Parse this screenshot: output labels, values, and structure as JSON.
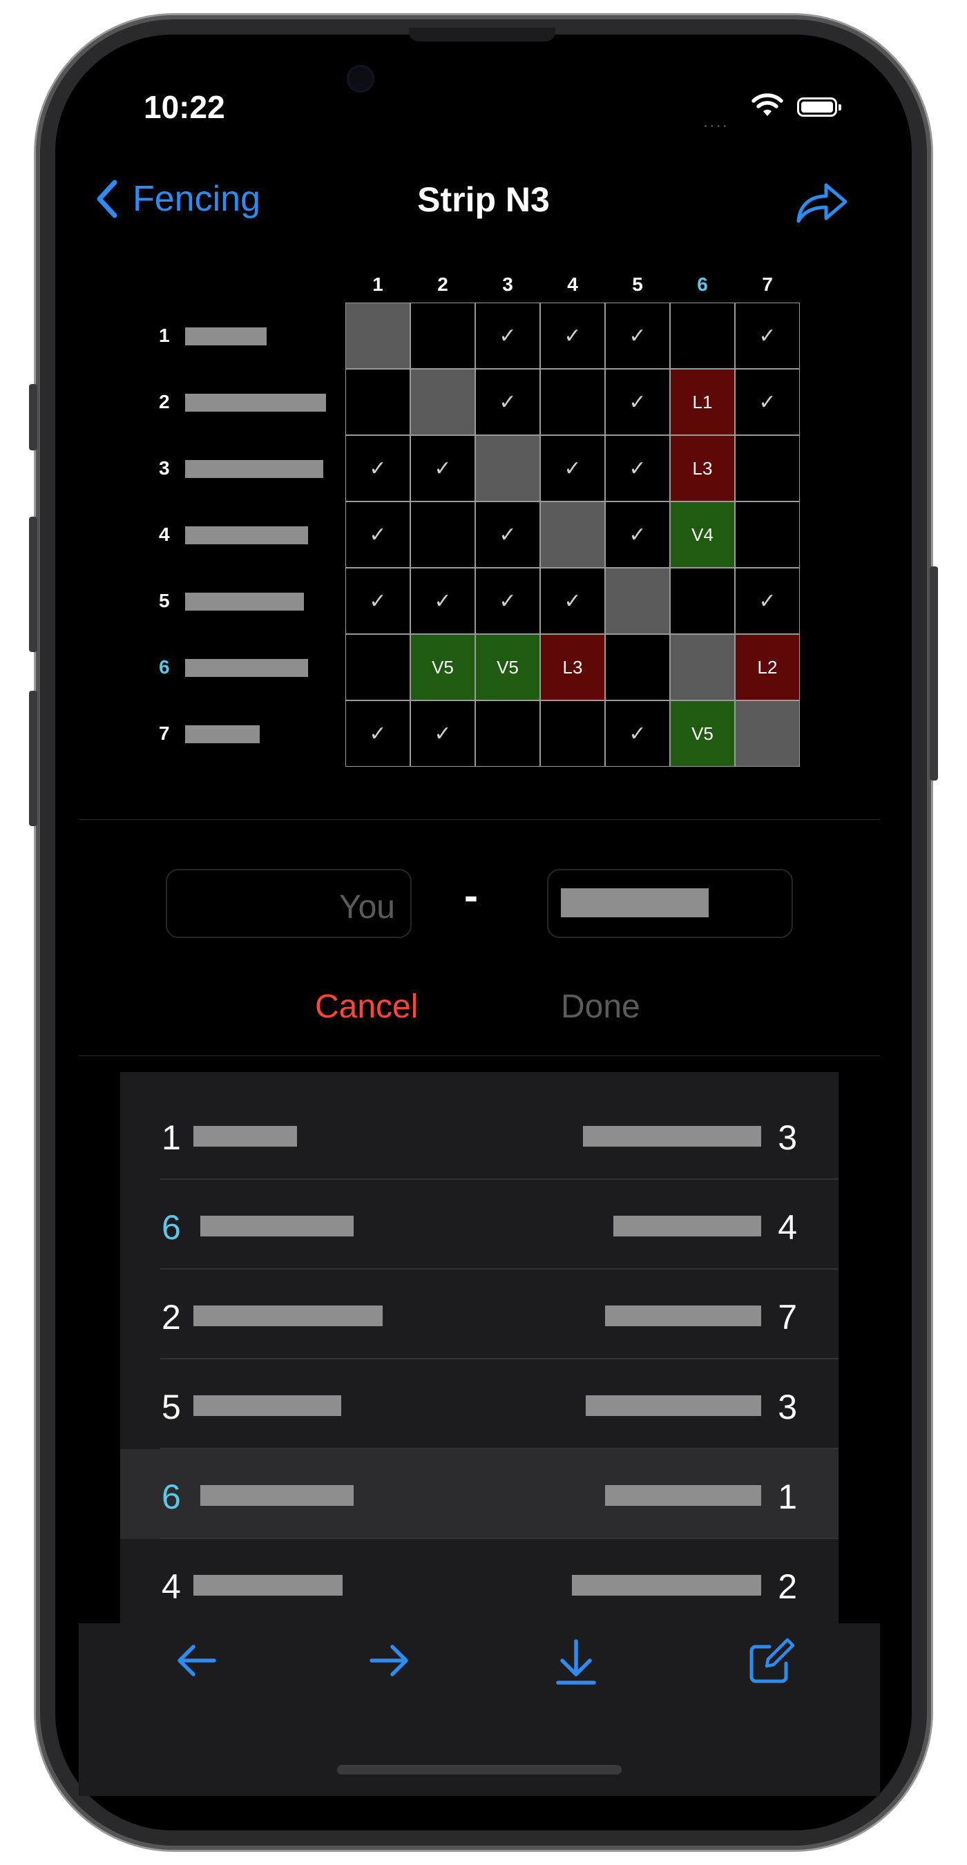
{
  "status_bar": {
    "time": "10:22",
    "dots": "....",
    "icons": [
      "wifi-icon",
      "battery-icon"
    ]
  },
  "nav": {
    "back_label": "Fencing",
    "title": "Strip N3",
    "share_icon": "share-icon"
  },
  "pool": {
    "columns": [
      "1",
      "2",
      "3",
      "4",
      "5",
      "6",
      "7"
    ],
    "highlight_index": 6,
    "rows": [
      {
        "num": "1",
        "cells": [
          "",
          "",
          "✓",
          "✓",
          "✓",
          "",
          "✓"
        ]
      },
      {
        "num": "2",
        "cells": [
          "",
          "",
          "✓",
          "",
          "✓",
          "L1",
          "✓"
        ]
      },
      {
        "num": "3",
        "cells": [
          "✓",
          "✓",
          "",
          "✓",
          "✓",
          "L3",
          ""
        ]
      },
      {
        "num": "4",
        "cells": [
          "✓",
          "",
          "✓",
          "",
          "✓",
          "V4",
          ""
        ]
      },
      {
        "num": "5",
        "cells": [
          "✓",
          "✓",
          "✓",
          "✓",
          "",
          "",
          "✓"
        ]
      },
      {
        "num": "6",
        "cells": [
          "",
          "V5",
          "V5",
          "L3",
          "",
          "",
          "L2"
        ]
      },
      {
        "num": "7",
        "cells": [
          "✓",
          "✓",
          "",
          "",
          "✓",
          "V5",
          ""
        ]
      }
    ]
  },
  "score_entry": {
    "left_placeholder": "You",
    "separator": "-",
    "cancel_label": "Cancel",
    "done_label": "Done"
  },
  "bouts": [
    {
      "left": "1",
      "right": "3",
      "left_highlight": false,
      "selected": false
    },
    {
      "left": "6",
      "right": "4",
      "left_highlight": true,
      "selected": false
    },
    {
      "left": "2",
      "right": "7",
      "left_highlight": false,
      "selected": false
    },
    {
      "left": "5",
      "right": "3",
      "left_highlight": false,
      "selected": false
    },
    {
      "left": "6",
      "right": "1",
      "left_highlight": true,
      "selected": true
    },
    {
      "left": "4",
      "right": "2",
      "left_highlight": false,
      "selected": false
    }
  ],
  "toolbar": {
    "icons": [
      "arrow-left-icon",
      "arrow-right-icon",
      "download-icon",
      "compose-icon"
    ]
  },
  "colors": {
    "accent": "#2e8cf0",
    "highlight": "#5ac8e8",
    "win": "#1f5c12",
    "loss": "#5e0808",
    "cancel": "#ff453a"
  }
}
